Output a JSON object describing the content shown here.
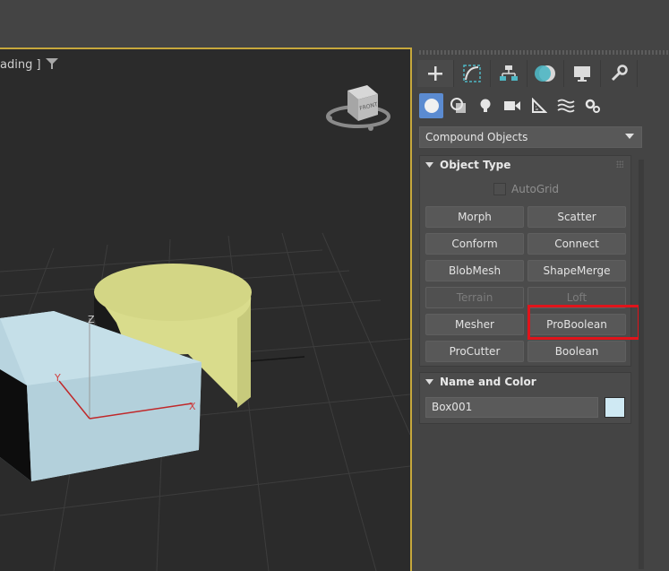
{
  "viewport": {
    "label": "ading ]",
    "navcube_face": "FRONT",
    "axis_labels": {
      "z": "Z",
      "y": "Y",
      "x": "X"
    }
  },
  "command_panel": {
    "tabs": [
      {
        "icon": "plus-icon",
        "active": true
      },
      {
        "icon": "modify-curve-icon"
      },
      {
        "icon": "hierarchy-icon"
      },
      {
        "icon": "motion-icon"
      },
      {
        "icon": "display-monitor-icon"
      },
      {
        "icon": "utilities-wrench-icon"
      }
    ],
    "categories": [
      {
        "icon": "geometry-sphere-icon",
        "active": true
      },
      {
        "icon": "shapes-icon"
      },
      {
        "icon": "lights-bulb-icon"
      },
      {
        "icon": "cameras-icon"
      },
      {
        "icon": "helpers-ruler-icon"
      },
      {
        "icon": "spacewarps-icon"
      },
      {
        "icon": "systems-gears-icon"
      }
    ],
    "dropdown": {
      "selected": "Compound Objects"
    },
    "object_type": {
      "title": "Object Type",
      "autogrid_label": "AutoGrid",
      "buttons": [
        "Morph",
        "Scatter",
        "Conform",
        "Connect",
        "BlobMesh",
        "ShapeMerge",
        "Terrain",
        "Loft",
        "Mesher",
        "ProBoolean",
        "ProCutter",
        "Boolean"
      ],
      "disabled": [
        "Terrain",
        "Loft"
      ],
      "highlighted": "ProBoolean"
    },
    "name_and_color": {
      "title": "Name and Color",
      "name_value": "Box001",
      "color": "#cfe9f3"
    }
  },
  "colors": {
    "accent_active": "#5b8bd1",
    "viewport_border": "#c7a83c",
    "highlight_box": "#e0141b",
    "box_object": "#b9d6e0",
    "cylinder_object": "#dde08f"
  }
}
